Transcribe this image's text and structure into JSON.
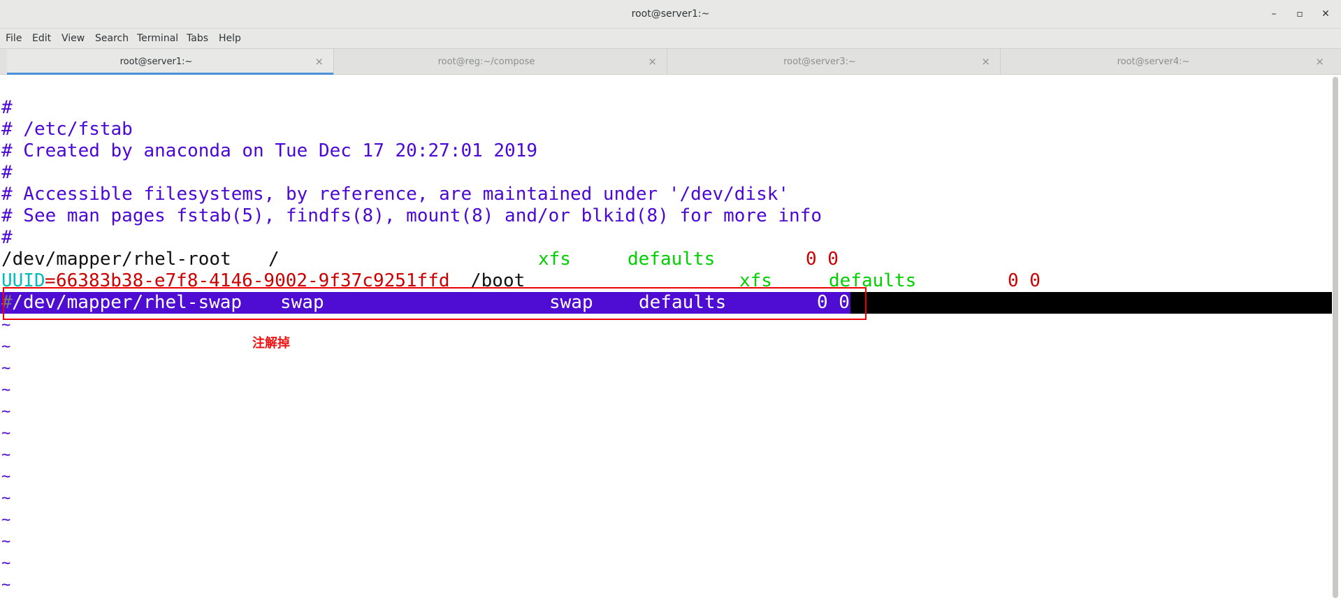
{
  "window": {
    "title": "root@server1:~",
    "minimize": "–",
    "maximize": "▫",
    "close": "✕"
  },
  "menu": [
    "File",
    "Edit",
    "View",
    "Search",
    "Terminal",
    "Tabs",
    "Help"
  ],
  "tabs": [
    {
      "label": "root@server1:~",
      "active": true
    },
    {
      "label": "root@reg:~/compose",
      "active": false
    },
    {
      "label": "root@server3:~",
      "active": false
    },
    {
      "label": "root@server4:~",
      "active": false
    }
  ],
  "tab_close_glyph": "×",
  "editor": {
    "comment_lines": [
      "#",
      "# /etc/fstab",
      "# Created by anaconda on Tue Dec 17 20:27:01 2019",
      "#",
      "# Accessible filesystems, by reference, are maintained under '/dev/disk'",
      "# See man pages fstab(5), findfs(8), mount(8) and/or blkid(8) for more info",
      "#"
    ],
    "root_line": {
      "device": "/dev/mapper/rhel-root",
      "mount": "/",
      "fstype": "xfs",
      "options": "defaults",
      "dump_pass": "0 0"
    },
    "boot_line": {
      "key": "UUID",
      "eq": "=",
      "uuid": "66383b38-e7f8-4146-9002-9f37c9251ffd",
      "mount": "/boot",
      "fstype": "xfs",
      "options": "defaults",
      "dump_pass": "0 0"
    },
    "swap_line": {
      "hash": "#",
      "slash": "/",
      "device_rest": "dev/mapper/rhel-swap",
      "mount": "swap",
      "fstype": "swap",
      "options": "defaults",
      "dump_pass": "0 0"
    },
    "tilde": "~",
    "tilde_count": 13
  },
  "annotation": "注解掉",
  "colors": {
    "comment": "#4b07d6",
    "green": "#00d000",
    "red": "#cc0000",
    "cyan": "#00bcbc",
    "selection": "#4f0cd3",
    "highlight_box": "#ee0000",
    "tab_indicator": "#4a90d9"
  }
}
